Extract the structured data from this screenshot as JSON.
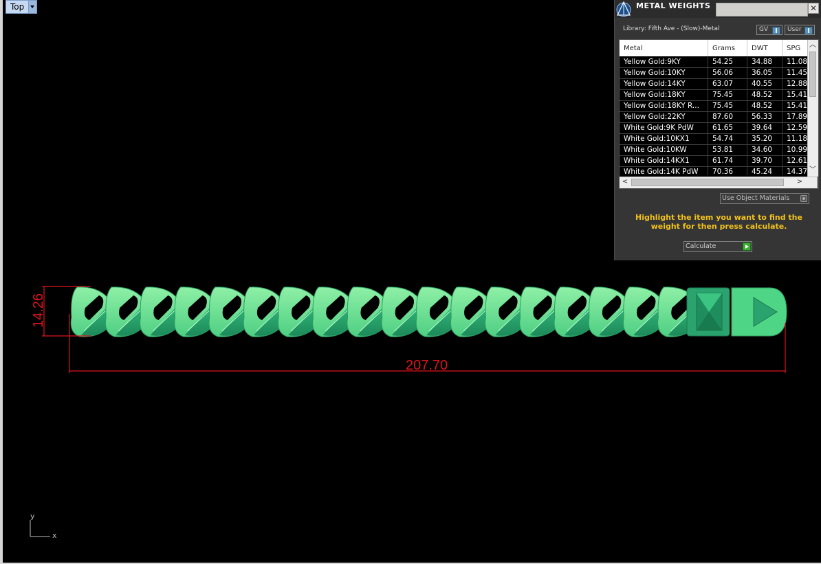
{
  "viewport": {
    "name": "Top",
    "dimension_height": "14.26",
    "dimension_length": "207.70",
    "axis_y": "y",
    "axis_x": "x"
  },
  "colors": {
    "dimension": "#e0141c",
    "link_light": "#6fe08f",
    "link_dark": "#2aa36e",
    "hint": "#f2c21b"
  },
  "panel": {
    "title": "METAL WEIGHTS",
    "close_icon": "close-icon",
    "library_label": "Library: Fifth Ave - (Slow)-Metal",
    "toggle_gv": "GV",
    "toggle_user": "User",
    "columns": [
      "Metal",
      "Grams",
      "DWT",
      "SPG"
    ],
    "rows": [
      {
        "metal": "Yellow Gold:9KY",
        "grams": "54.25",
        "dwt": "34.88",
        "spg": "11.08"
      },
      {
        "metal": "Yellow Gold:10KY",
        "grams": "56.06",
        "dwt": "36.05",
        "spg": "11.45"
      },
      {
        "metal": "Yellow Gold:14KY",
        "grams": "63.07",
        "dwt": "40.55",
        "spg": "12.88"
      },
      {
        "metal": "Yellow Gold:18KY",
        "grams": "75.45",
        "dwt": "48.52",
        "spg": "15.41"
      },
      {
        "metal": "Yellow Gold:18KY R...",
        "grams": "75.45",
        "dwt": "48.52",
        "spg": "15.41"
      },
      {
        "metal": "Yellow Gold:22KY",
        "grams": "87.60",
        "dwt": "56.33",
        "spg": "17.89"
      },
      {
        "metal": "White Gold:9K PdW",
        "grams": "61.65",
        "dwt": "39.64",
        "spg": "12.59"
      },
      {
        "metal": "White Gold:10KX1",
        "grams": "54.74",
        "dwt": "35.20",
        "spg": "11.18"
      },
      {
        "metal": "White Gold:10KW",
        "grams": "53.81",
        "dwt": "34.60",
        "spg": "10.99"
      },
      {
        "metal": "White Gold:14KX1",
        "grams": "61.74",
        "dwt": "39.70",
        "spg": "12.61"
      },
      {
        "metal": "White Gold:14K PdW",
        "grams": "70.36",
        "dwt": "45.24",
        "spg": "14.37"
      }
    ],
    "use_object_materials": "Use Object Materials",
    "hint": "Highlight the item you want to find the weight for then press calculate.",
    "calculate_label": "Calculate"
  }
}
